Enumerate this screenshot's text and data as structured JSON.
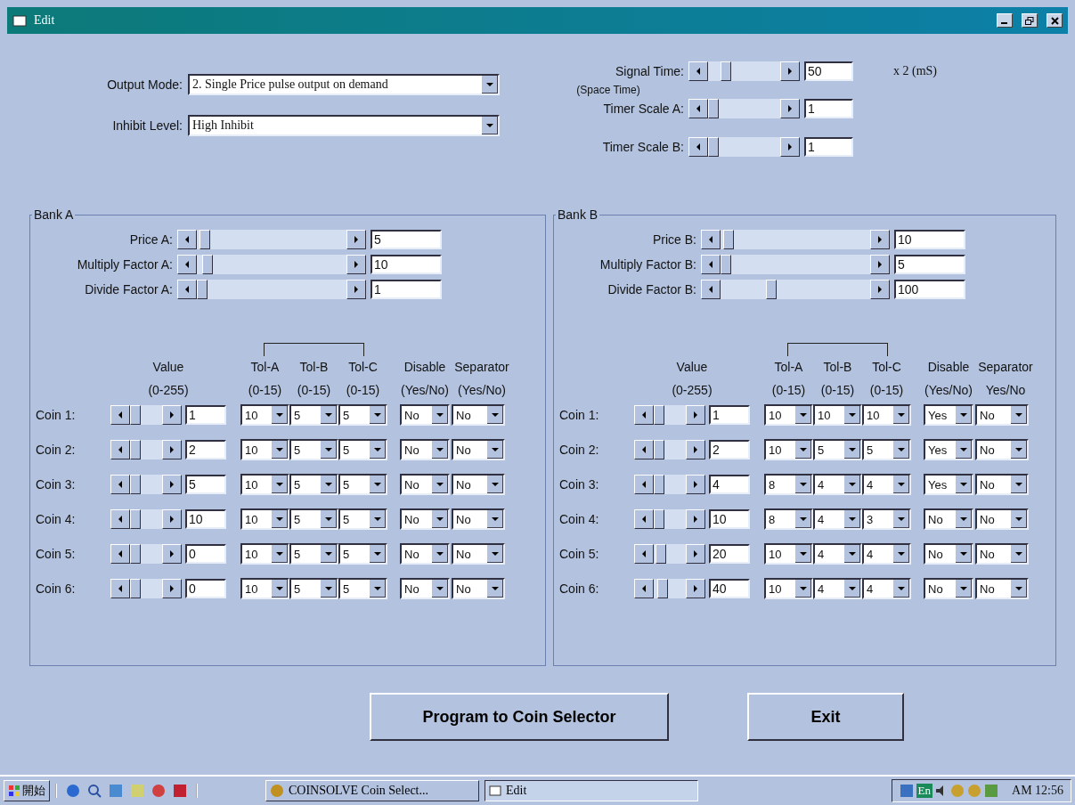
{
  "window": {
    "title": "Edit"
  },
  "top_left": [
    {
      "label": "Output Mode:",
      "value": "2. Single Price pulse output on demand"
    },
    {
      "label": "Inhibit Level:",
      "value": "High Inhibit"
    }
  ],
  "timers": [
    {
      "label": "Signal Time:",
      "sublabel": "(Space Time)",
      "level": 0.2,
      "value": "50",
      "unit": "x 2 (mS)"
    },
    {
      "label": "Timer Scale A:",
      "level": 0,
      "value": "1"
    },
    {
      "label": "Timer Scale B:",
      "level": 0,
      "value": "1"
    }
  ],
  "banks": [
    {
      "title": "Bank A",
      "sliders": [
        {
          "label": "Price A:",
          "level": 0.02,
          "value": "5"
        },
        {
          "label": "Multiply Factor A:",
          "level": 0.04,
          "value": "10"
        },
        {
          "label": "Divide Factor A:",
          "level": 0,
          "value": "1"
        }
      ],
      "headers": [
        "Value",
        "Tol-A",
        "Tol-B",
        "Tol-C",
        "Disable",
        "Separator"
      ],
      "subheaders": [
        "(0-255)",
        "(0-15)",
        "(0-15)",
        "(0-15)",
        "(Yes/No)",
        "(Yes/No)"
      ],
      "coins": [
        {
          "label": "Coin 1:",
          "level": 0,
          "value": "1",
          "tolerances": [
            "10",
            "5",
            "5"
          ],
          "disable": "No",
          "separator": "No"
        },
        {
          "label": "Coin 2:",
          "level": 0,
          "value": "2",
          "tolerances": [
            "10",
            "5",
            "5"
          ],
          "disable": "No",
          "separator": "No"
        },
        {
          "label": "Coin 3:",
          "level": 0,
          "value": "5",
          "tolerances": [
            "10",
            "5",
            "5"
          ],
          "disable": "No",
          "separator": "No"
        },
        {
          "label": "Coin 4:",
          "level": 0,
          "value": "10",
          "tolerances": [
            "10",
            "5",
            "5"
          ],
          "disable": "No",
          "separator": "No"
        },
        {
          "label": "Coin 5:",
          "level": 0,
          "value": "0",
          "tolerances": [
            "10",
            "5",
            "5"
          ],
          "disable": "No",
          "separator": "No"
        },
        {
          "label": "Coin 6:",
          "level": 0,
          "value": "0",
          "tolerances": [
            "10",
            "5",
            "5"
          ],
          "disable": "No",
          "separator": "No"
        }
      ]
    },
    {
      "title": "Bank B",
      "sliders": [
        {
          "label": "Price B:",
          "level": 0.02,
          "value": "10"
        },
        {
          "label": "Multiply Factor B:",
          "level": 0,
          "value": "5"
        },
        {
          "label": "Divide Factor B:",
          "level": 0.33,
          "value": "100"
        }
      ],
      "headers": [
        "Value",
        "Tol-A",
        "Tol-B",
        "Tol-C",
        "Disable",
        "Separator"
      ],
      "subheaders": [
        "(0-255)",
        "(0-15)",
        "(0-15)",
        "(0-15)",
        "(Yes/No)",
        "Yes/No"
      ],
      "coins": [
        {
          "label": "Coin 1:",
          "level": 0,
          "value": "1",
          "tolerances": [
            "10",
            "10",
            "10"
          ],
          "disable": "Yes",
          "separator": "No"
        },
        {
          "label": "Coin 2:",
          "level": 0,
          "value": "2",
          "tolerances": [
            "10",
            "5",
            "5"
          ],
          "disable": "Yes",
          "separator": "No"
        },
        {
          "label": "Coin 3:",
          "level": 0,
          "value": "4",
          "tolerances": [
            "8",
            "4",
            "4"
          ],
          "disable": "Yes",
          "separator": "No"
        },
        {
          "label": "Coin 4:",
          "level": 0,
          "value": "10",
          "tolerances": [
            "8",
            "4",
            "3"
          ],
          "disable": "No",
          "separator": "No"
        },
        {
          "label": "Coin 5:",
          "level": 0.08,
          "value": "20",
          "tolerances": [
            "10",
            "4",
            "4"
          ],
          "disable": "No",
          "separator": "No"
        },
        {
          "label": "Coin 6:",
          "level": 0.16,
          "value": "40",
          "tolerances": [
            "10",
            "4",
            "4"
          ],
          "disable": "No",
          "separator": "No"
        }
      ]
    }
  ],
  "buttons": [
    "Program to Coin Selector",
    "Exit"
  ],
  "taskbar": {
    "start": "開始",
    "tasks": [
      {
        "label": "COINSOLVE  Coin Select...",
        "selected": false
      },
      {
        "label": "Edit",
        "selected": true
      }
    ],
    "tray_text": "En",
    "clock": "AM 12:56"
  }
}
